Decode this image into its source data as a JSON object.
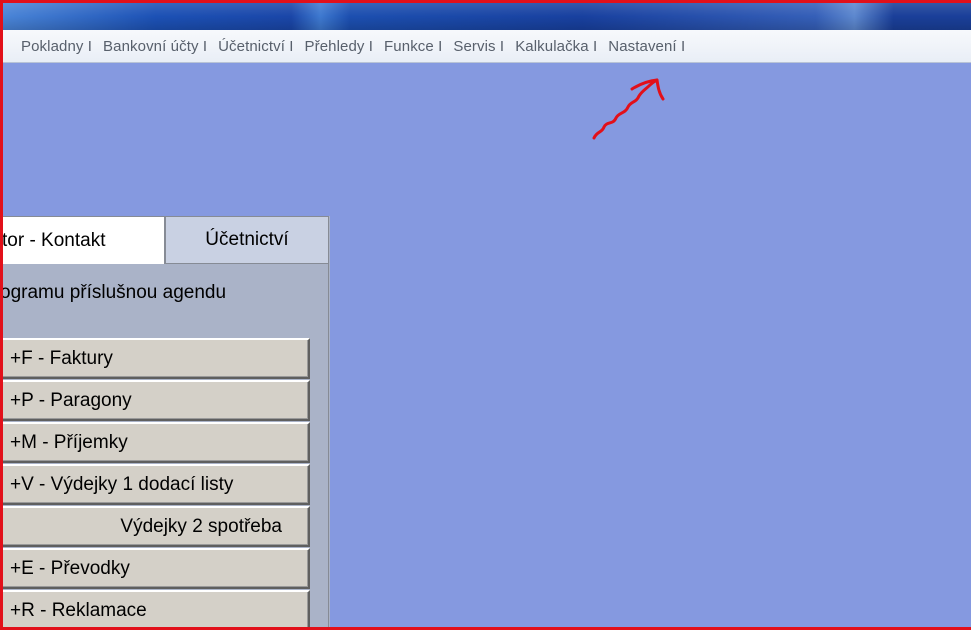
{
  "menubar": {
    "items": [
      "Pokladny I",
      "Bankovní účty I",
      "Účetnictví I",
      "Přehledy I",
      "Funkce I",
      "Servis I",
      "Kalkulačka I",
      "Nastavení I"
    ]
  },
  "panel": {
    "tabs": [
      "tor - Kontakt",
      "Účetnictví"
    ],
    "instruction": "ogramu příslušnou agendu",
    "buttons": [
      "+F - Faktury",
      "+P - Paragony",
      "+M - Příjemky",
      "+V - Výdejky 1 dodací listy",
      "Výdejky 2 spotřeba",
      "+E - Převodky",
      "+R - Reklamace"
    ]
  },
  "colors": {
    "desktop": "#8599e0",
    "panel": "#aab3c8",
    "annotation": "#e2101a"
  }
}
